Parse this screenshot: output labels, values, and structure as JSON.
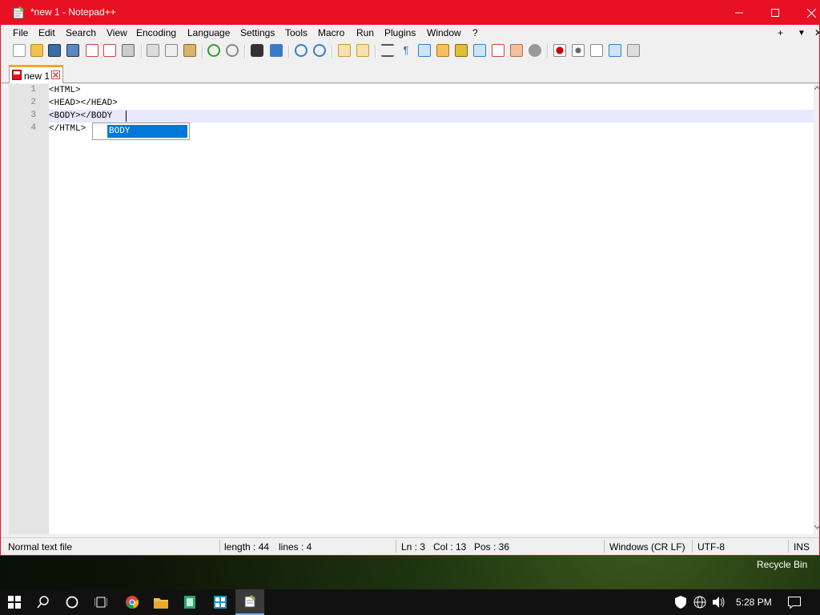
{
  "window": {
    "title": "*new 1 - Notepad++"
  },
  "menu": [
    "File",
    "Edit",
    "Search",
    "View",
    "Encoding",
    "Language",
    "Settings",
    "Tools",
    "Macro",
    "Run",
    "Plugins",
    "Window",
    "?"
  ],
  "menu_extra": {
    "plus": "+",
    "dropdown": "▼",
    "close": "✕"
  },
  "tab": {
    "label": "new 1"
  },
  "editor": {
    "lines": [
      {
        "num": "1",
        "text": "<HTML>"
      },
      {
        "num": "2",
        "text": "<HEAD></HEAD>"
      },
      {
        "num": "3",
        "text": "<BODY></BODY"
      },
      {
        "num": "4",
        "text": "</HTML>"
      }
    ],
    "autocomplete": [
      "BODY"
    ]
  },
  "status": {
    "filetype": "Normal text file",
    "length": "length : 44",
    "lines": "lines : 4",
    "ln": "Ln : 3",
    "col": "Col : 13",
    "pos": "Pos : 36",
    "eol": "Windows (CR LF)",
    "encoding": "UTF-8",
    "mode": "INS"
  },
  "desktop": {
    "recycle_bin": "Recycle Bin"
  },
  "taskbar": {
    "time": "5:28 PM"
  },
  "colors": {
    "titlebar": "#e81123",
    "selection": "#0078d7",
    "tab_accent": "#f5a623"
  }
}
